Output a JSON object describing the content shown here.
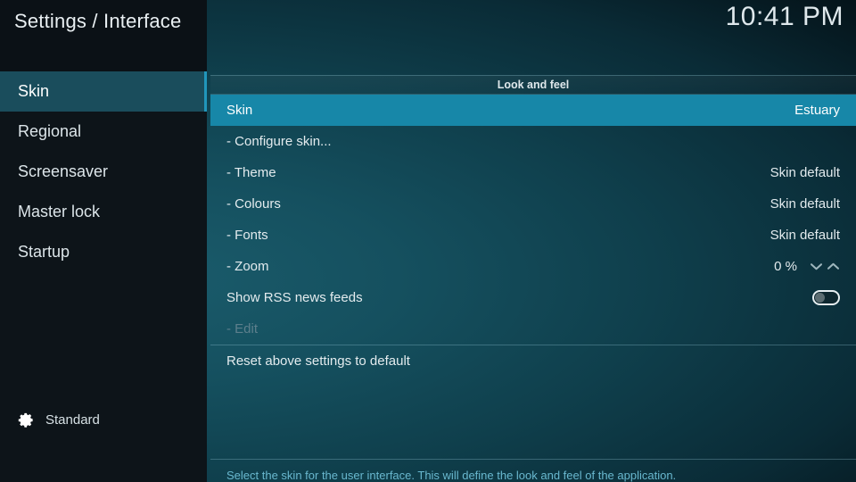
{
  "header": {
    "title": "Settings / Interface",
    "clock": "10:41 PM"
  },
  "sidebar": {
    "items": [
      {
        "label": "Skin",
        "selected": true
      },
      {
        "label": "Regional",
        "selected": false
      },
      {
        "label": "Screensaver",
        "selected": false
      },
      {
        "label": "Master lock",
        "selected": false
      },
      {
        "label": "Startup",
        "selected": false
      }
    ],
    "profile": {
      "icon": "gear-icon",
      "label": "Standard"
    }
  },
  "main": {
    "group_header": "Look and feel",
    "rows": [
      {
        "label": "Skin",
        "value": "Estuary",
        "type": "value",
        "selected": true,
        "disabled": false
      },
      {
        "label": "- Configure skin...",
        "value": "",
        "type": "action",
        "selected": false,
        "disabled": false
      },
      {
        "label": "- Theme",
        "value": "Skin default",
        "type": "value",
        "selected": false,
        "disabled": false
      },
      {
        "label": "- Colours",
        "value": "Skin default",
        "type": "value",
        "selected": false,
        "disabled": false
      },
      {
        "label": "- Fonts",
        "value": "Skin default",
        "type": "value",
        "selected": false,
        "disabled": false
      },
      {
        "label": "- Zoom",
        "value": "0 %",
        "type": "spinner",
        "selected": false,
        "disabled": false
      },
      {
        "label": "Show RSS news feeds",
        "value": "",
        "type": "toggle",
        "selected": false,
        "disabled": false,
        "toggle_on": false
      },
      {
        "label": "- Edit",
        "value": "",
        "type": "action",
        "selected": false,
        "disabled": true
      },
      {
        "label": "Reset above settings to default",
        "value": "",
        "type": "action",
        "selected": false,
        "disabled": false
      }
    ],
    "help_text": "Select the skin for the user interface. This will define the look and feel of the application."
  },
  "colors": {
    "accent": "#1787a8",
    "sidebar_selected": "#1a4d5c",
    "sidebar_bg": "#0d1419",
    "header_bg": "#0b1116",
    "help_text": "#69b8cf",
    "disabled_text": "#5d7f8c"
  }
}
